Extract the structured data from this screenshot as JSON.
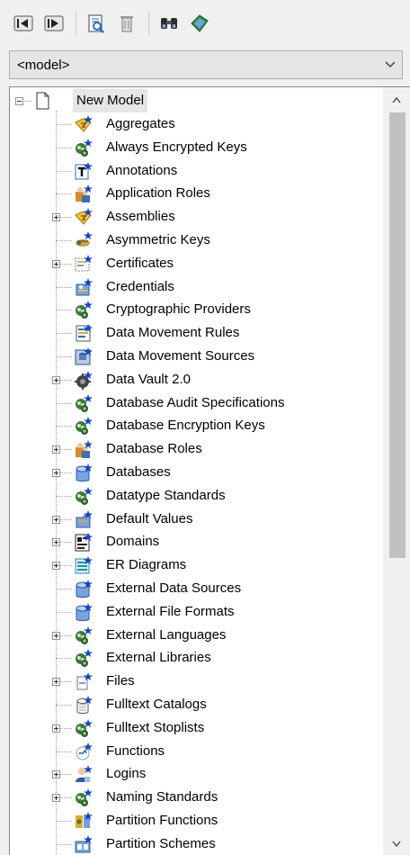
{
  "toolbar": {
    "buttons": [
      {
        "name": "collapse-left-button",
        "icon": "arrow-left-icon"
      },
      {
        "name": "expand-right-button",
        "icon": "arrow-right-icon"
      },
      {
        "name": "properties-button",
        "icon": "magnify-document-icon"
      },
      {
        "name": "delete-button",
        "icon": "trash-icon"
      },
      {
        "name": "find-button",
        "icon": "binoculars-icon"
      },
      {
        "name": "filter-button",
        "icon": "tag-icon"
      }
    ]
  },
  "selector": {
    "value": "<model>"
  },
  "tree": {
    "root": {
      "label": "New Model",
      "expanded": true
    },
    "items": [
      {
        "label": "Aggregates",
        "icon": "lightning-folder-icon",
        "expandable": false
      },
      {
        "label": "Always Encrypted Keys",
        "icon": "key-people-icon",
        "expandable": false
      },
      {
        "label": "Annotations",
        "icon": "text-annotation-icon",
        "expandable": false
      },
      {
        "label": "Application Roles",
        "icon": "people-role-icon",
        "expandable": false
      },
      {
        "label": "Assemblies",
        "icon": "lightning-folder-icon",
        "expandable": true
      },
      {
        "label": "Asymmetric Keys",
        "icon": "keys-icon",
        "expandable": false
      },
      {
        "label": "Certificates",
        "icon": "certificate-icon",
        "expandable": true
      },
      {
        "label": "Credentials",
        "icon": "credential-icon",
        "expandable": false
      },
      {
        "label": "Cryptographic Providers",
        "icon": "key-people-icon",
        "expandable": false
      },
      {
        "label": "Data Movement Rules",
        "icon": "rules-document-icon",
        "expandable": false
      },
      {
        "label": "Data Movement Sources",
        "icon": "data-source-icon",
        "expandable": false
      },
      {
        "label": "Data Vault 2.0",
        "icon": "gear-vault-icon",
        "expandable": true
      },
      {
        "label": "Database Audit Specifications",
        "icon": "key-people-icon",
        "expandable": false
      },
      {
        "label": "Database Encryption Keys",
        "icon": "key-people-icon",
        "expandable": false
      },
      {
        "label": "Database Roles",
        "icon": "people-role-icon",
        "expandable": true
      },
      {
        "label": "Databases",
        "icon": "database-cylinder-icon",
        "expandable": true
      },
      {
        "label": "Datatype Standards",
        "icon": "key-people-icon",
        "expandable": false
      },
      {
        "label": "Default Values",
        "icon": "default-values-icon",
        "expandable": true
      },
      {
        "label": "Domains",
        "icon": "domain-icon",
        "expandable": true
      },
      {
        "label": "ER Diagrams",
        "icon": "er-diagram-icon",
        "expandable": true
      },
      {
        "label": "External Data Sources",
        "icon": "database-cylinder-icon",
        "expandable": false
      },
      {
        "label": "External File Formats",
        "icon": "database-cylinder-icon",
        "expandable": false
      },
      {
        "label": "External Languages",
        "icon": "key-people-icon",
        "expandable": true
      },
      {
        "label": "External Libraries",
        "icon": "key-people-icon",
        "expandable": false
      },
      {
        "label": "Files",
        "icon": "file-icon",
        "expandable": true
      },
      {
        "label": "Fulltext Catalogs",
        "icon": "catalog-cylinder-icon",
        "expandable": false
      },
      {
        "label": "Fulltext Stoplists",
        "icon": "key-people-icon",
        "expandable": true
      },
      {
        "label": "Functions",
        "icon": "function-icon",
        "expandable": false
      },
      {
        "label": "Logins",
        "icon": "login-person-icon",
        "expandable": true
      },
      {
        "label": "Naming Standards",
        "icon": "key-people-icon",
        "expandable": true
      },
      {
        "label": "Partition Functions",
        "icon": "partition-function-icon",
        "expandable": false
      },
      {
        "label": "Partition Schemes",
        "icon": "partition-scheme-icon",
        "expandable": false
      }
    ]
  },
  "scrollbar": {
    "position": 0.0,
    "visible_fraction": 0.62
  },
  "colors": {
    "accent_blue": "#1f6fd0",
    "star_blue": "#1144cc",
    "root_highlight": "#e6e6e6",
    "border": "#828790"
  }
}
